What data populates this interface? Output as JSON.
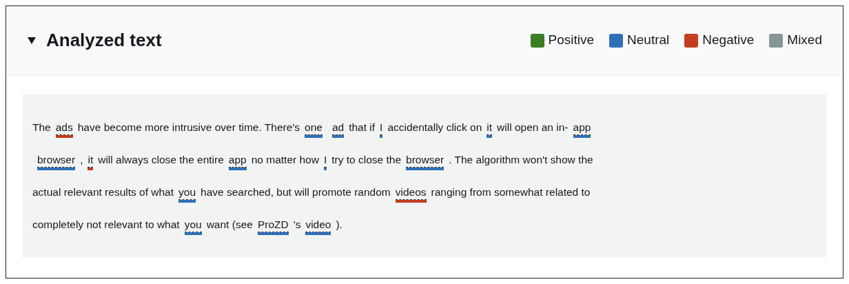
{
  "header": {
    "title": "Analyzed text",
    "expanded": true
  },
  "legend": [
    {
      "label": "Positive",
      "color": "#3b7d23"
    },
    {
      "label": "Neutral",
      "color": "#2f6fba"
    },
    {
      "label": "Negative",
      "color": "#c33d1f"
    },
    {
      "label": "Mixed",
      "color": "#879596"
    }
  ],
  "lines": [
    [
      {
        "kind": "text",
        "text": "The"
      },
      {
        "kind": "entity",
        "text": "ads",
        "color": "#c33d1f"
      },
      {
        "kind": "text",
        "text": "have become more intrusive over time. There's"
      },
      {
        "kind": "entity",
        "text": "one",
        "color": "#2f6fba"
      },
      {
        "kind": "entity",
        "text": "ad",
        "color": "#2f6fba"
      },
      {
        "kind": "text",
        "text": "that if"
      },
      {
        "kind": "entity",
        "text": "I",
        "color": "#2f6fba"
      },
      {
        "kind": "text",
        "text": "accidentally click on"
      },
      {
        "kind": "entity",
        "text": "it",
        "color": "#2f6fba"
      },
      {
        "kind": "text",
        "text": "will open an in-"
      },
      {
        "kind": "entity",
        "text": "app",
        "color": "#2f6fba"
      }
    ],
    [
      {
        "kind": "entity",
        "text": "browser",
        "color": "#2f6fba"
      },
      {
        "kind": "text",
        "text": ","
      },
      {
        "kind": "entity",
        "text": "it",
        "color": "#c33d1f"
      },
      {
        "kind": "text",
        "text": "will always close the entire"
      },
      {
        "kind": "entity",
        "text": "app",
        "color": "#2f6fba"
      },
      {
        "kind": "text",
        "text": "no matter how"
      },
      {
        "kind": "entity",
        "text": "I",
        "color": "#2f6fba"
      },
      {
        "kind": "text",
        "text": "try to close the"
      },
      {
        "kind": "entity",
        "text": "browser",
        "color": "#2f6fba"
      },
      {
        "kind": "text",
        "text": ". The algorithm won't show the"
      }
    ],
    [
      {
        "kind": "text",
        "text": "actual relevant results of what"
      },
      {
        "kind": "entity",
        "text": "you",
        "color": "#2f6fba"
      },
      {
        "kind": "text",
        "text": "have searched, but will promote random"
      },
      {
        "kind": "entity",
        "text": "videos",
        "color": "#c33d1f"
      },
      {
        "kind": "text",
        "text": "ranging from somewhat related to"
      }
    ],
    [
      {
        "kind": "text",
        "text": "completely not relevant to what"
      },
      {
        "kind": "entity",
        "text": "you",
        "color": "#2f6fba"
      },
      {
        "kind": "text",
        "text": "want (see"
      },
      {
        "kind": "entity",
        "text": "ProZD",
        "color": "#2f6fba"
      },
      {
        "kind": "text",
        "text": "'s"
      },
      {
        "kind": "entity",
        "text": "video",
        "color": "#2f6fba"
      },
      {
        "kind": "text",
        "text": ")."
      }
    ]
  ]
}
